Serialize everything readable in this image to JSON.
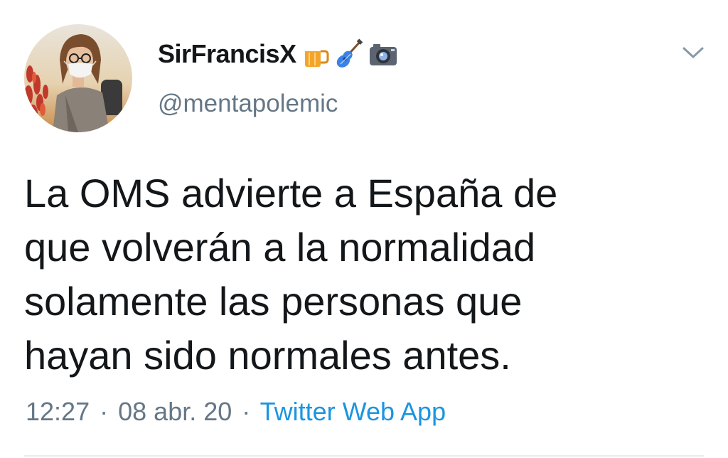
{
  "user": {
    "display_name": "SirFrancisX",
    "handle": "@mentapolemic",
    "name_emojis": [
      "beer-mug-emoji",
      "guitar-emoji",
      "camera-emoji"
    ]
  },
  "tweet": {
    "text_lines": [
      "La OMS advierte a España de",
      "que volverán a la normalidad",
      "solamente las personas que",
      "hayan sido normales antes."
    ],
    "time": "12:27",
    "date": "08 abr. 20",
    "separator": "·",
    "source": "Twitter Web App"
  },
  "icons": {
    "menu": "chevron-down-icon"
  },
  "colors": {
    "text": "#14171a",
    "secondary": "#657786",
    "link": "#1b95e0"
  }
}
